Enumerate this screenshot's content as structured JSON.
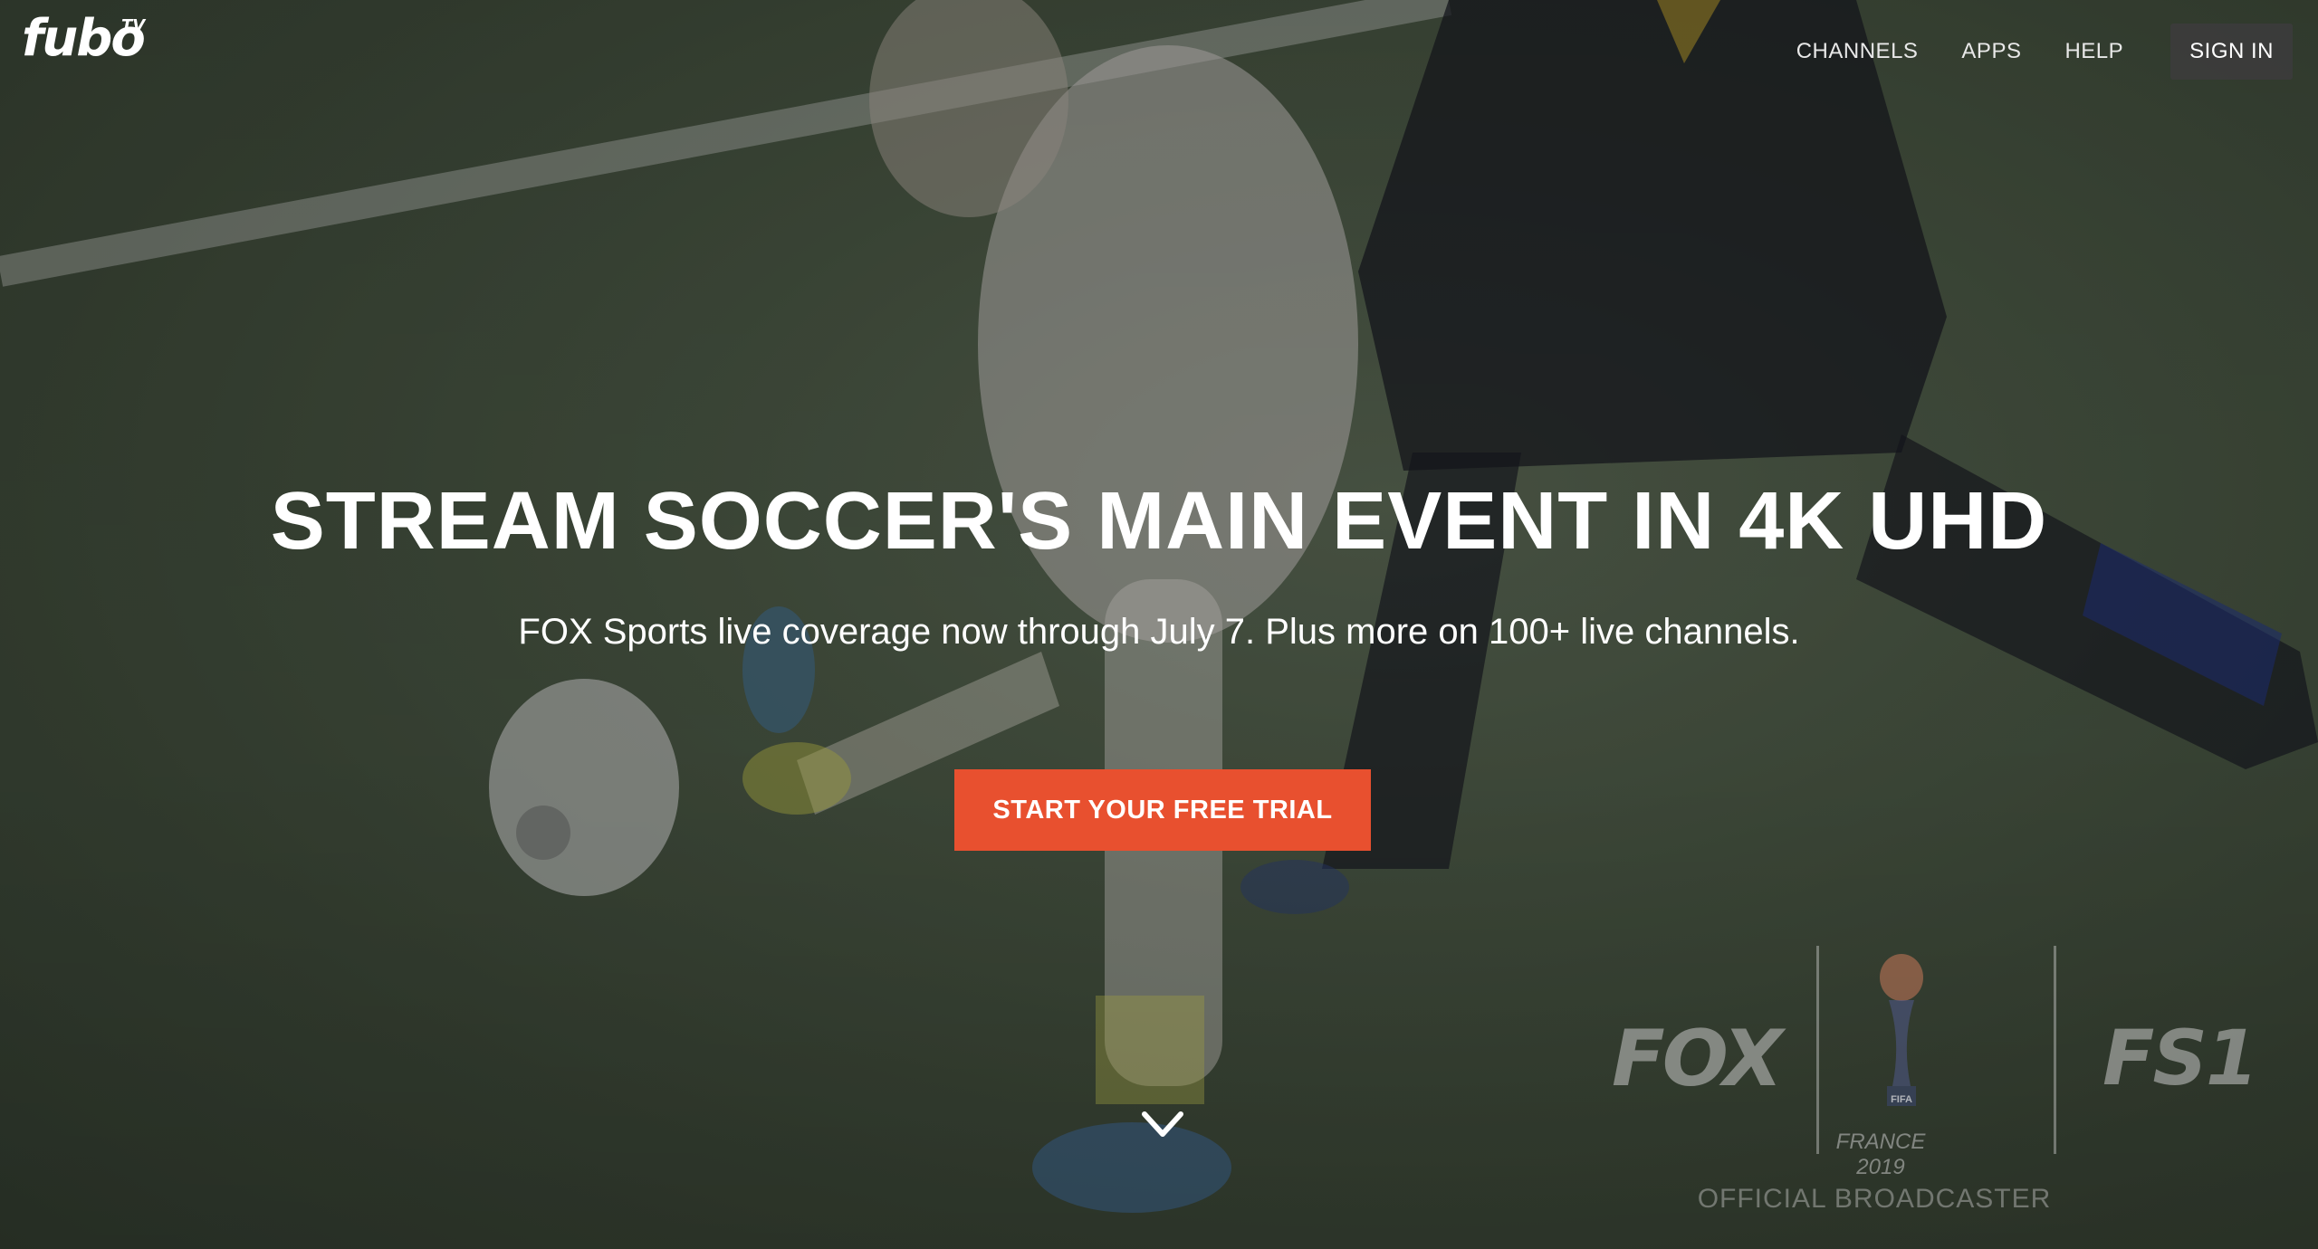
{
  "brand": {
    "logo_text": "fubo",
    "logo_superscript": "TV"
  },
  "nav": {
    "items": [
      "CHANNELS",
      "APPS",
      "HELP"
    ],
    "sign_in_label": "SIGN IN"
  },
  "hero": {
    "headline": "STREAM SOCCER'S MAIN EVENT IN 4K UHD",
    "subhead": "FOX Sports live coverage now through July 7. Plus more on 100+ live channels.",
    "cta_label": "START YOUR FREE TRIAL",
    "cta_color": "#e8502f",
    "scroll_icon": "chevron-down-icon"
  },
  "broadcast": {
    "fox_logo_text": "FOX",
    "fifa_caption": "FRANCE 2019",
    "fs1_logo_text": "FS1",
    "official_label": "OFFICIAL BROADCASTER"
  }
}
